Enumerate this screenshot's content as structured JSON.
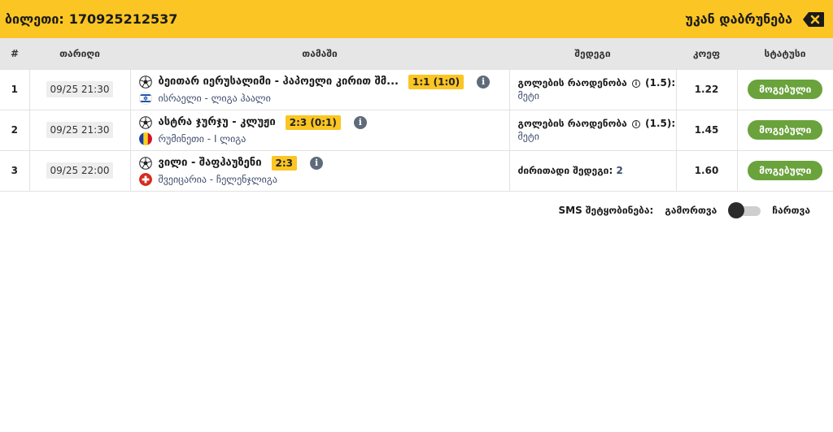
{
  "header": {
    "ticket_label": "ბილეთი:",
    "ticket_number": "170925212537",
    "back_label": "უკან დაბრუნება",
    "back_icon": "backspace-icon"
  },
  "table": {
    "columns": [
      "#",
      "თარიღი",
      "თამაში",
      "შედეგი",
      "კოეფ",
      "სტატუსი"
    ],
    "rows": [
      {
        "num": "1",
        "date": "09/25 21:30",
        "sport_icon": "soccer-ball-icon",
        "teams": "ბეითარ იერუსალიმი - ჰაპოელი კირით შმ...",
        "score": "1:1 (1:0)",
        "flag": "israel-flag-icon",
        "league": "ისრაელი - ლიგა ჰაალი",
        "market": "გოლების რაოდენობა",
        "market_line": "(1.5):",
        "selection": "მეტი",
        "odds": "1.22",
        "status": "მოგებული"
      },
      {
        "num": "2",
        "date": "09/25 21:30",
        "sport_icon": "soccer-ball-icon",
        "teams": "ასტრა ჯურჯუ - კლუჟი",
        "score": "2:3 (0:1)",
        "flag": "romania-flag-icon",
        "league": "რუმინეთი - I ლიგა",
        "market": "გოლების რაოდენობა",
        "market_line": "(1.5):",
        "selection": "მეტი",
        "odds": "1.45",
        "status": "მოგებული"
      },
      {
        "num": "3",
        "date": "09/25 22:00",
        "sport_icon": "soccer-ball-icon",
        "teams": "ვილი - შაფჰაუზენი",
        "score": "2:3",
        "flag": "switzerland-flag-icon",
        "league": "შვეიცარია - ჩელენჯლიგა",
        "market": "ძირითადი შედეგი:",
        "market_line": "",
        "selection": "2",
        "odds": "1.60",
        "status": "მოგებული"
      }
    ]
  },
  "sms": {
    "label": "SMS შეტყობინება:",
    "off_label": "გამორთვა",
    "on_label": "ჩართვა",
    "state": "off"
  },
  "colors": {
    "accent": "#fbc523",
    "won": "#6aa23c",
    "header_bg": "#e6e6e6",
    "link": "#3d4c6b"
  }
}
